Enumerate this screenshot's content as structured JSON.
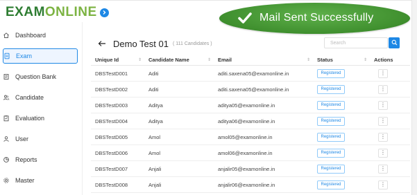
{
  "logo": {
    "part1": "EXAM",
    "part2": "ONLINE",
    "icon": "chevron-right-icon"
  },
  "sidebar": {
    "items": [
      {
        "label": "Dashboard",
        "icon": "home-icon",
        "active": false
      },
      {
        "label": "Exam",
        "icon": "document-icon",
        "active": true
      },
      {
        "label": "Question Bank",
        "icon": "book-icon",
        "active": false
      },
      {
        "label": "Candidate",
        "icon": "users-icon",
        "active": false
      },
      {
        "label": "Evaluation",
        "icon": "clipboard-icon",
        "active": false
      },
      {
        "label": "User",
        "icon": "user-icon",
        "active": false
      },
      {
        "label": "Reports",
        "icon": "pie-chart-icon",
        "active": false
      },
      {
        "label": "Master",
        "icon": "gear-icon",
        "active": false
      }
    ]
  },
  "header": {
    "title": "Demo Test 01",
    "subtitle": "( 111 Candidates )",
    "back_icon": "arrow-left-icon"
  },
  "search": {
    "placeholder": "Search",
    "icon": "search-icon"
  },
  "table": {
    "columns": [
      "Unique Id",
      "Candidate Name",
      "Email",
      "Status",
      "Actions"
    ],
    "rows": [
      {
        "id": "DBSTestD001",
        "name": "Aditi",
        "email": "aditi.saxena05@examonline.in",
        "status": "Registered",
        "action": "⋮"
      },
      {
        "id": "DBSTestD002",
        "name": "Aditi",
        "email": "aditi.saxena05@examonline.in",
        "status": "Registered",
        "action": "⋮"
      },
      {
        "id": "DBSTestD003",
        "name": "Aditya",
        "email": "aditya05@examonline.in",
        "status": "Registered",
        "action": "⋮"
      },
      {
        "id": "DBSTestD004",
        "name": "Aditya",
        "email": "aditya06@examonline.in",
        "status": "Registered",
        "action": "⋮"
      },
      {
        "id": "DBSTestD005",
        "name": "Amol",
        "email": "amol05@examonline.in",
        "status": "Registered",
        "action": "⋮"
      },
      {
        "id": "DBSTestD006",
        "name": "Amol",
        "email": "amol06@examonline.in",
        "status": "Registered",
        "action": "⋮"
      },
      {
        "id": "DBSTestD007",
        "name": "Anjali",
        "email": "anjalir05@examonline.in",
        "status": "Registered",
        "action": "⋮"
      },
      {
        "id": "DBSTestD008",
        "name": "Anjali",
        "email": "anjalir06@examonline.in",
        "status": "Registered",
        "action": "⋮"
      }
    ]
  },
  "toast": {
    "message": "Mail Sent Successfully",
    "icon": "check-icon"
  },
  "colors": {
    "primary": "#1e88e5",
    "brand_dark": "#2e7d32",
    "brand_light": "#7cb342",
    "toast": "#4a9e3a"
  }
}
